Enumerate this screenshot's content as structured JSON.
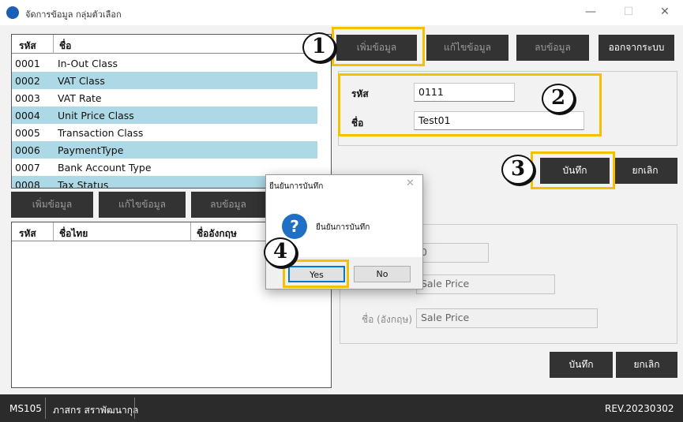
{
  "window": {
    "title": "จัดการข้อมูล กลุ่มตัวเลือก",
    "minimize_icon": "—",
    "maximize_icon": "☐",
    "close_icon": "✕"
  },
  "group_list": {
    "columns": [
      "รหัส",
      "ชื่อ"
    ],
    "rows": [
      {
        "code": "0001",
        "name": "In-Out Class"
      },
      {
        "code": "0002",
        "name": "VAT Class"
      },
      {
        "code": "0003",
        "name": "VAT Rate"
      },
      {
        "code": "0004",
        "name": "Unit Price Class"
      },
      {
        "code": "0005",
        "name": "Transaction Class"
      },
      {
        "code": "0006",
        "name": "PaymentType"
      },
      {
        "code": "0007",
        "name": "Bank Account Type"
      },
      {
        "code": "0008",
        "name": "Tax Status"
      }
    ]
  },
  "group_buttons": {
    "add": "เพิ่มข้อมูล",
    "edit": "แก้ไขข้อมูล",
    "delete": "ลบข้อมูล",
    "exit": "ออกจากระบบ"
  },
  "group_form": {
    "code_label": "รหัส",
    "code_value": "0111",
    "name_label": "ชื่อ",
    "name_value": "Test01",
    "save": "บันทึก",
    "cancel": "ยกเลิก"
  },
  "sub_buttons": {
    "add": "เพิ่มข้อมูล",
    "edit": "แก้ไขข้อมูล",
    "delete": "ลบข้อมูล"
  },
  "sub_list": {
    "columns": [
      "รหัส",
      "ชื่อไทย",
      "ชื่ออังกฤษ"
    ]
  },
  "sub_form": {
    "code_value": "0",
    "thai_name_value": "Sale Price",
    "eng_name_label": "ชื่อ (อังกฤษ)",
    "eng_name_value": "Sale Price",
    "save": "บันทึก",
    "cancel": "ยกเลิก"
  },
  "dialog": {
    "title": "ยืนยันการบันทึก",
    "close_icon": "✕",
    "icon": "?",
    "message": "ยืนยันการบันทึก",
    "yes": "Yes",
    "no": "No"
  },
  "callouts": [
    "1",
    "2",
    "3",
    "4"
  ],
  "status_bar": {
    "program_code": "MS105",
    "user_name": "ภาสกร สราพัฒนากุล",
    "revision": "REV.20230302"
  },
  "colors": {
    "highlight": "#f2c200",
    "alt_row": "#add8e6",
    "dark_button": "#333333",
    "status_bar": "#2b2b2b"
  }
}
